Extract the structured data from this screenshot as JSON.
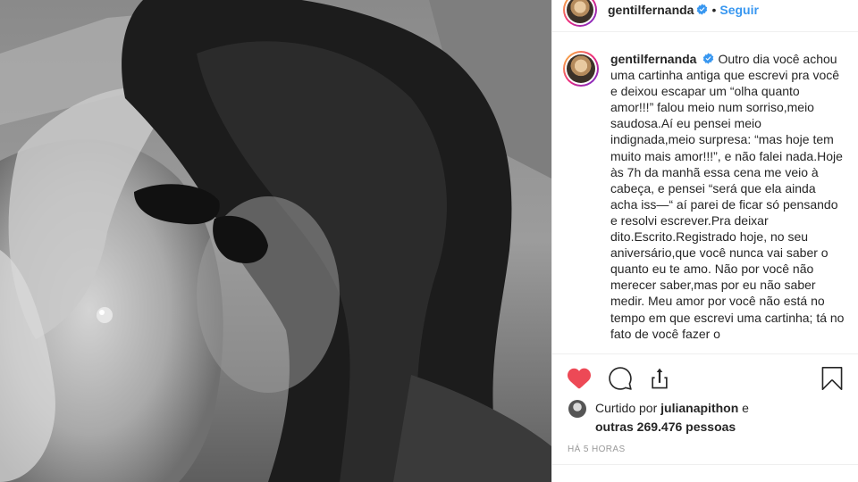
{
  "post": {
    "username": "gentilfernanda",
    "follow_label": "Seguir",
    "separator": "•",
    "caption": "Outro dia você achou uma cartinha antiga que escrevi pra você e deixou escapar um “olha quanto amor!!!” falou meio num sorriso,meio saudosa.Aí eu pensei meio indignada,meio surpresa: “mas hoje tem muito mais amor!!!”, e não falei nada.Hoje às 7h da manhã essa cena me veio à cabeça, e pensei “será que ela ainda acha iss—“ aí parei de ficar só pensando e resolvi escrever.Pra deixar dito.Escrito.Registrado hoje, no seu aniversário,que você nunca vai saber o quanto eu te amo. Não por você não merecer saber,mas por eu não saber medir. Meu amor por você não está no tempo em que escrevi uma cartinha; tá no fato de você fazer o",
    "likes": {
      "prefix": "Curtido por",
      "liker": "julianapithon",
      "joiner": "e",
      "others": "outras 269.476 pessoas"
    },
    "timestamp": "HÁ 5 HORAS"
  },
  "icons": {
    "like": "heart-filled-icon",
    "comment": "comment-icon",
    "share": "share-icon",
    "save": "bookmark-icon",
    "verified": "verified-badge-icon"
  },
  "colors": {
    "like_active": "#ed4956",
    "link_blue": "#3897f0",
    "text": "#262626",
    "muted": "#999999",
    "border": "#efefef"
  }
}
